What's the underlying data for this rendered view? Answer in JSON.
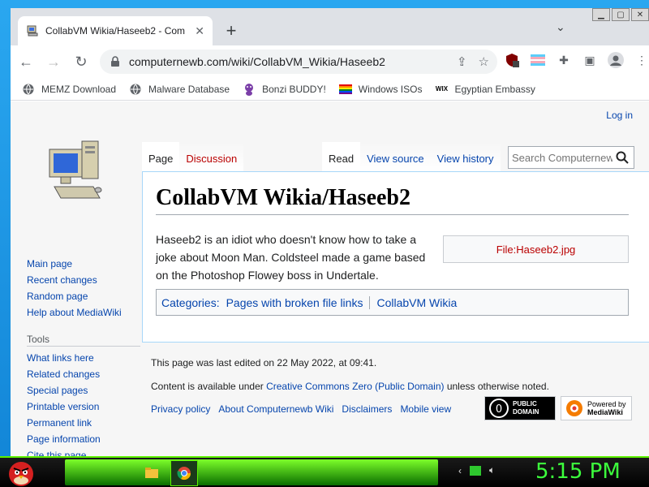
{
  "browser": {
    "tab_title": "CollabVM Wikia/Haseeb2 - Comp",
    "url": "computernewb.com/wiki/CollabVM_Wikia/Haseeb2",
    "bookmarks": [
      {
        "label": "MEMZ Download",
        "icon": "globe-icon"
      },
      {
        "label": "Malware Database",
        "icon": "globe-icon"
      },
      {
        "label": "Bonzi BUDDY!",
        "icon": "bonzi-icon"
      },
      {
        "label": "Windows ISOs",
        "icon": "rainbow-flag-icon"
      },
      {
        "label": "Egyptian Embassy",
        "icon": "wix-icon"
      }
    ]
  },
  "wiki": {
    "login": "Log in",
    "tabs_left": [
      "Page",
      "Discussion"
    ],
    "tabs_right": [
      "Read",
      "View source",
      "View history"
    ],
    "search_placeholder": "Search Computernew",
    "title": "CollabVM Wikia/Haseeb2",
    "body": "Haseeb2 is an idiot who doesn't know how to take a joke about Moon Man. Coldsteel made a game based on the Photoshop Flowey boss in Undertale.",
    "file_link": "File:Haseeb2.jpg",
    "categories_label": "Categories",
    "categories": [
      "Pages with broken file links",
      "CollabVM Wikia"
    ],
    "sidebar_nav": [
      "Main page",
      "Recent changes",
      "Random page",
      "Help about MediaWiki"
    ],
    "tools_heading": "Tools",
    "tools": [
      "What links here",
      "Related changes",
      "Special pages",
      "Printable version",
      "Permanent link",
      "Page information",
      "Cite this page"
    ],
    "footer_edited": "This page was last edited on 22 May 2022, at 09:41.",
    "footer_content_prefix": "Content is available under ",
    "footer_license": "Creative Commons Zero (Public Domain)",
    "footer_content_suffix": " unless otherwise noted.",
    "footer_links": [
      "Privacy policy",
      "About Computernewb Wiki",
      "Disclaimers",
      "Mobile view"
    ],
    "badge_pd": "PUBLIC DOMAIN",
    "badge_mw_top": "Powered by",
    "badge_mw_bottom": "MediaWiki"
  },
  "taskbar": {
    "clock": "5:15 PM"
  }
}
